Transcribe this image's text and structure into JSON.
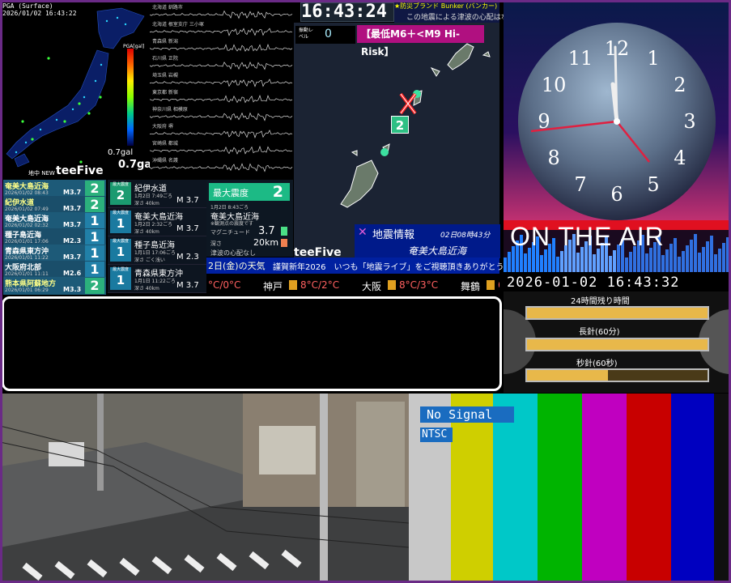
{
  "pga": {
    "title": "PGA (Surface)",
    "timestamp": "2026/01/02 16:43:22",
    "scale_label": "PGA[gal]",
    "gal_small": "0.7gal",
    "gal_big": "0.7gal",
    "new_label": "地中 NEW",
    "brand": "teeFive"
  },
  "waveforms": [
    {
      "label": "北海道 釧路市"
    },
    {
      "label": "北海道 根室支庁 三小塚"
    },
    {
      "label": "青森県 新潟"
    },
    {
      "label": "石川県 正院"
    },
    {
      "label": "埼玉県 岩槻"
    },
    {
      "label": "東京都 新宿"
    },
    {
      "label": "神奈川県 相模原"
    },
    {
      "label": "大阪府 堺"
    },
    {
      "label": "宮崎県 都城"
    },
    {
      "label": "沖縄県 名護"
    }
  ],
  "history": [
    {
      "name": "奄美大島近海",
      "sub": "2026/01/02 08:43",
      "mag": "M3.7",
      "intensity": "2"
    },
    {
      "name": "紀伊水道",
      "sub": "2026/01/02 07:49",
      "mag": "M3.7",
      "intensity": "2"
    },
    {
      "name": "奄美大島近海",
      "sub": "2026/01/02 02:32",
      "mag": "M3.7",
      "intensity": "1"
    },
    {
      "name": "種子島近海",
      "sub": "2026/01/01 17:06",
      "mag": "M2.3",
      "intensity": "1"
    },
    {
      "name": "青森県東方沖",
      "sub": "2026/01/01 11:22",
      "mag": "M3.7",
      "intensity": "1"
    },
    {
      "name": "大阪府北部",
      "sub": "2026/01/01 11:11",
      "mag": "M2.6",
      "intensity": "1"
    },
    {
      "name": "熊本県阿蘇地方",
      "sub": "2026/01/01 06:29",
      "mag": "M3.3",
      "intensity": "2"
    }
  ],
  "history_header": "最大震度",
  "cards": [
    {
      "intensity": "2",
      "tiny": "最大震度",
      "name": "紀伊水道",
      "time": "1月2日 7:49ごろ",
      "depth": "深さ 40km",
      "mag": "M 3.7"
    },
    {
      "intensity": "1",
      "tiny": "最大震度",
      "name": "奄美大島近海",
      "time": "1月2日 2:32ごろ",
      "depth": "深さ 40km",
      "mag": "M 3.7"
    },
    {
      "intensity": "1",
      "tiny": "最大震度",
      "name": "種子島近海",
      "time": "1月1日 17:06ごろ",
      "depth": "深さ ごく浅い",
      "mag": "M 2.3"
    },
    {
      "intensity": "1",
      "tiny": "最大震度",
      "name": "青森県東方沖",
      "time": "1月1日 11:22ごろ",
      "depth": "深さ 40km",
      "mag": "M 3.7"
    }
  ],
  "detail": {
    "label": "最大震度",
    "value": "2",
    "time": "1月2日 8:43ごろ",
    "name": "奄美大島近海",
    "note": "※観測点の震度です",
    "mag_label": "マグニチュード",
    "mag": "3.7",
    "depth_label": "深さ",
    "depth": "20km",
    "tsunami": "津波の心配なし"
  },
  "clock": {
    "time": "16:43:24",
    "tsunami_head": "★防災ブランド Bunker (バンカー)",
    "tsunami_msg": "この地震による津波の心配はなし",
    "level_label": "振動レベル",
    "level": "0",
    "risk": "【最低M6＋<M9 Hi-Risk】"
  },
  "map": {
    "epicenter_intensity": "2",
    "info_title": "地震情報",
    "info_time": "02日08時43分",
    "info_place": "奄美大島近海",
    "brand": "teeFive"
  },
  "ticker": {
    "weather_title": "2日(金)の天気",
    "message": "謹賀新年2026　いつも「地震ライブ」をご視聴頂きありがとうございます!",
    "cities": [
      {
        "name": "",
        "temp": "°C/0°C"
      },
      {
        "name": "神戸",
        "temp": "8°C/2°C"
      },
      {
        "name": "大阪",
        "temp": "8°C/3°C"
      },
      {
        "name": "舞鶴",
        "temp": "6°"
      }
    ]
  },
  "right": {
    "on_air": "ON THE AIR",
    "datetime": "2026-01-02 16:43:32",
    "bars": [
      {
        "label": "24時間残り時間",
        "progress": 1.0
      },
      {
        "label": "長針(60分)",
        "progress": 1.0
      },
      {
        "label": "秒針(60秒)",
        "progress": 0.45
      }
    ],
    "clock_numbers": [
      "12",
      "1",
      "2",
      "3",
      "4",
      "5",
      "6",
      "7",
      "8",
      "9",
      "10",
      "11"
    ]
  },
  "signal": {
    "no_signal": "No Signal",
    "mode": "NTSC",
    "bar_colors": [
      "#c8c8c8",
      "#cfcf00",
      "#00c8c8",
      "#00b400",
      "#c000c0",
      "#c80000",
      "#0000c0",
      "#101010"
    ]
  }
}
